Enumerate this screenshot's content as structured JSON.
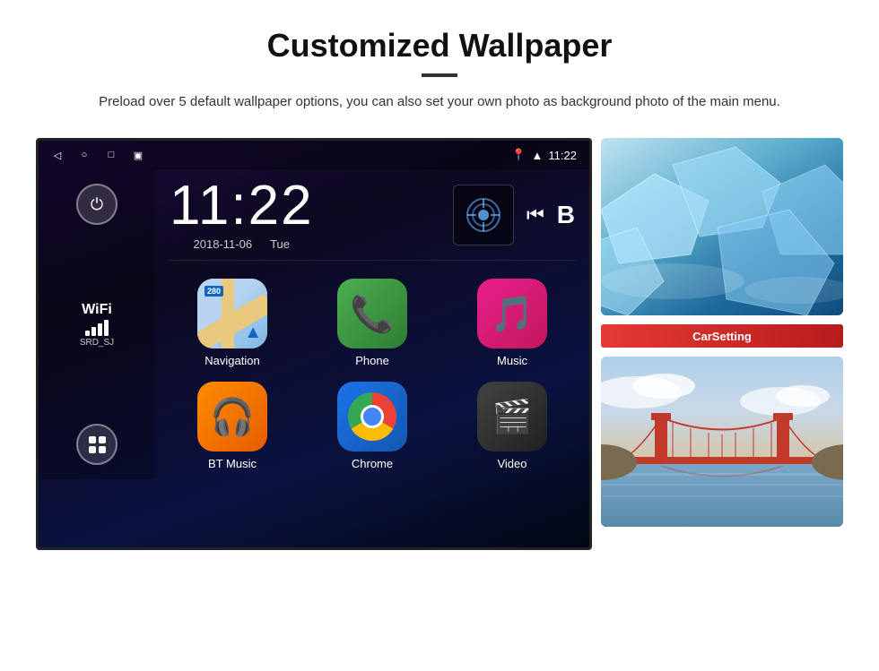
{
  "header": {
    "title": "Customized Wallpaper",
    "divider": true,
    "subtitle": "Preload over 5 default wallpaper options, you can also set your own photo as background photo of the main menu."
  },
  "android": {
    "statusBar": {
      "navBack": "◁",
      "navHome": "○",
      "navRecent": "□",
      "navCamera": "⊞",
      "locationIcon": "📍",
      "wifiIcon": "▲",
      "time": "11:22"
    },
    "clock": {
      "time": "11:22",
      "date": "2018-11-06",
      "day": "Tue"
    },
    "wifi": {
      "label": "WiFi",
      "ssid": "SRD_SJ"
    },
    "apps": [
      {
        "id": "navigation",
        "label": "Navigation",
        "badge": "280"
      },
      {
        "id": "phone",
        "label": "Phone"
      },
      {
        "id": "music",
        "label": "Music"
      },
      {
        "id": "bt-music",
        "label": "BT Music"
      },
      {
        "id": "chrome",
        "label": "Chrome"
      },
      {
        "id": "video",
        "label": "Video"
      }
    ],
    "carsetting": "CarSetting"
  }
}
